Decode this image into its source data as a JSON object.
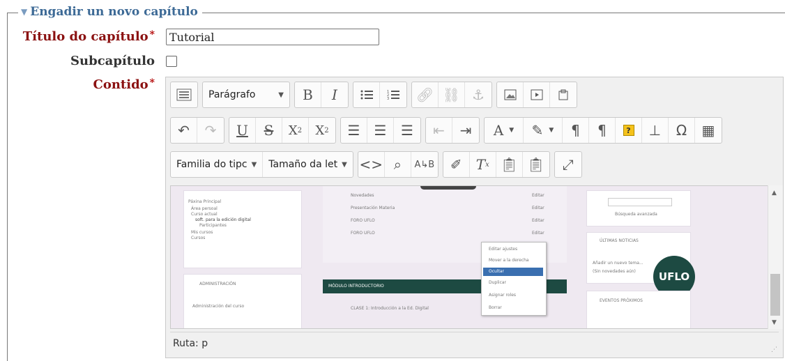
{
  "legend": {
    "text": "Engadir un novo capítulo"
  },
  "fields": {
    "title_label": "Título do capítulo",
    "title_value": "Tutorial",
    "subchapter_label": "Subcapítulo",
    "content_label": "Contido",
    "required_mark": "*"
  },
  "toolbar": {
    "format_select": "Parágrafo",
    "font_family_select": "Familia do tipc",
    "font_size_select": "Tamaño da let",
    "help": "?"
  },
  "content_image": {
    "nav": [
      "Páxina Principal",
      "Área persoal",
      "Curso actual",
      "soft. para la edición digital",
      "Participantes",
      "Mis cursos",
      "Cursos"
    ],
    "admin": "ADMINISTRACIÓN",
    "admin_item": "Administración del curso",
    "forum_items": [
      "Novedades",
      "Presentación Materia",
      "FORO UFLO",
      "FORO UFLO"
    ],
    "edit": "Editar",
    "menu": [
      "Editar ajustes",
      "Mover a la derecha",
      "Ocultar",
      "Duplicar",
      "Asignar roles",
      "Borrar"
    ],
    "module": "MÓDULO INTRODUCTORIO",
    "class": "CLASE 1: Introducción a la Ed. Digital",
    "search": "Búsqueda avanzada",
    "news": "ÚLTIMAS NOTICIAS",
    "add_topic": "Añadir un nuevo tema...",
    "no_news": "(Sin novedades aún)",
    "events": "EVENTOS PRÓXIMOS",
    "logo": "UFLO"
  },
  "path_label": "Ruta: p",
  "colors": {
    "legend": "#3d6a96",
    "label_red": "#8b1111",
    "module_bar": "#1d4a42",
    "logo_circle": "#1d4a42"
  }
}
